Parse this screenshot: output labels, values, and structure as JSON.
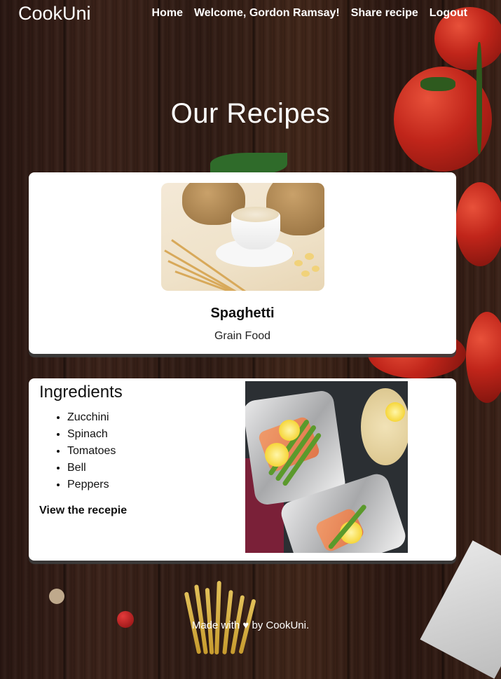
{
  "header": {
    "brand": "CookUni",
    "nav": {
      "home": "Home",
      "welcome": "Welcome, Gordon Ramsay!",
      "share": "Share recipe",
      "logout": "Logout"
    }
  },
  "main": {
    "title": "Our Recipes",
    "recipe_card": {
      "name": "Spaghetti",
      "category": "Grain Food"
    },
    "ingredients_card": {
      "heading": "Ingredients",
      "items": [
        "Zucchini",
        "Spinach",
        "Tomatoes",
        "Bell",
        "Peppers"
      ],
      "link": "View the recepie"
    }
  },
  "footer": {
    "text": "Made with ♥ by CookUni."
  },
  "colors": {
    "card_bg": "#ffffff",
    "text": "#111111",
    "header_text": "#ffffff"
  }
}
